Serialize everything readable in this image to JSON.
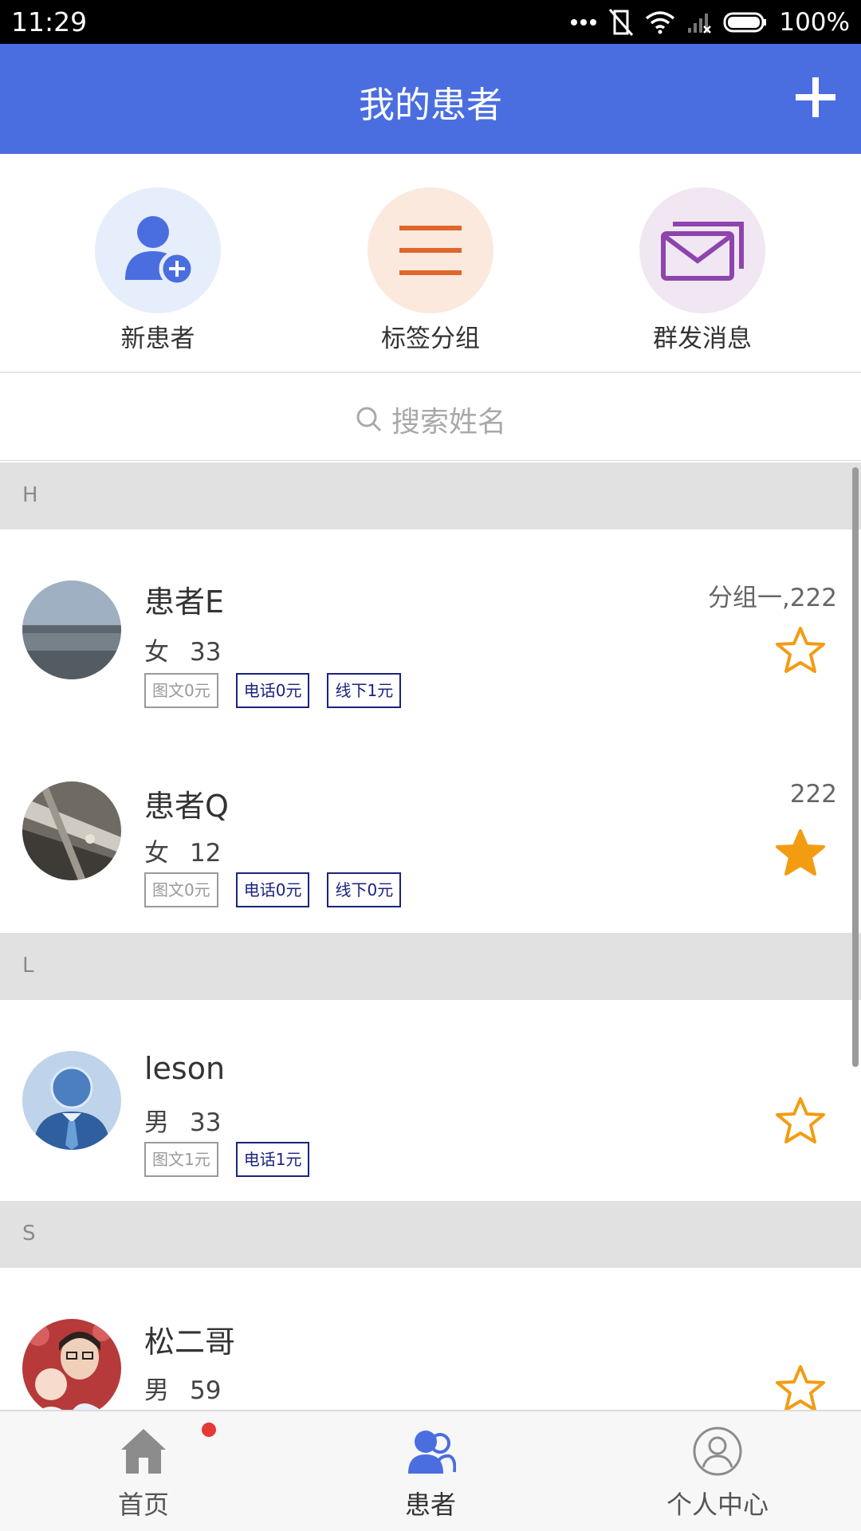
{
  "status_bar": {
    "time": "11:29",
    "battery": "100%"
  },
  "header": {
    "title": "我的患者",
    "add_icon": "plus-icon"
  },
  "quick_actions": [
    {
      "label": "新患者",
      "icon": "add-user-icon",
      "color": "#4a6ee0",
      "bg": "#e6eefc"
    },
    {
      "label": "标签分组",
      "icon": "menu-lines-icon",
      "color": "#e0662a",
      "bg": "#fbe9dd"
    },
    {
      "label": "群发消息",
      "icon": "mail-stack-icon",
      "color": "#8e44ad",
      "bg": "#f0e7f2"
    }
  ],
  "search": {
    "placeholder": "搜索姓名"
  },
  "sections": [
    {
      "letter": "H",
      "patients": [
        {
          "name": "患者E",
          "gender": "女",
          "age": "33",
          "group": "分组一,222",
          "starred": false,
          "tags": [
            {
              "label": "图文0元",
              "active": false
            },
            {
              "label": "电话0元",
              "active": true
            },
            {
              "label": "线下1元",
              "active": true
            }
          ]
        },
        {
          "name": "患者Q",
          "gender": "女",
          "age": "12",
          "group": "222",
          "starred": true,
          "tags": [
            {
              "label": "图文0元",
              "active": false
            },
            {
              "label": "电话0元",
              "active": true
            },
            {
              "label": "线下0元",
              "active": true
            }
          ]
        }
      ]
    },
    {
      "letter": "L",
      "patients": [
        {
          "name": "leson",
          "gender": "男",
          "age": "33",
          "group": "",
          "starred": false,
          "tags": [
            {
              "label": "图文1元",
              "active": false
            },
            {
              "label": "电话1元",
              "active": true
            }
          ]
        }
      ]
    },
    {
      "letter": "S",
      "patients": [
        {
          "name": "松二哥",
          "gender": "男",
          "age": "59",
          "group": "",
          "starred": false,
          "tags": []
        }
      ]
    }
  ],
  "bottom_nav": [
    {
      "label": "首页",
      "icon": "home-icon",
      "badge": true
    },
    {
      "label": "患者",
      "icon": "patients-icon",
      "active": true
    },
    {
      "label": "个人中心",
      "icon": "profile-icon"
    }
  ],
  "colors": {
    "primary": "#4a6ee0",
    "star": "#f39c12",
    "tag_active": "#1a237e"
  }
}
